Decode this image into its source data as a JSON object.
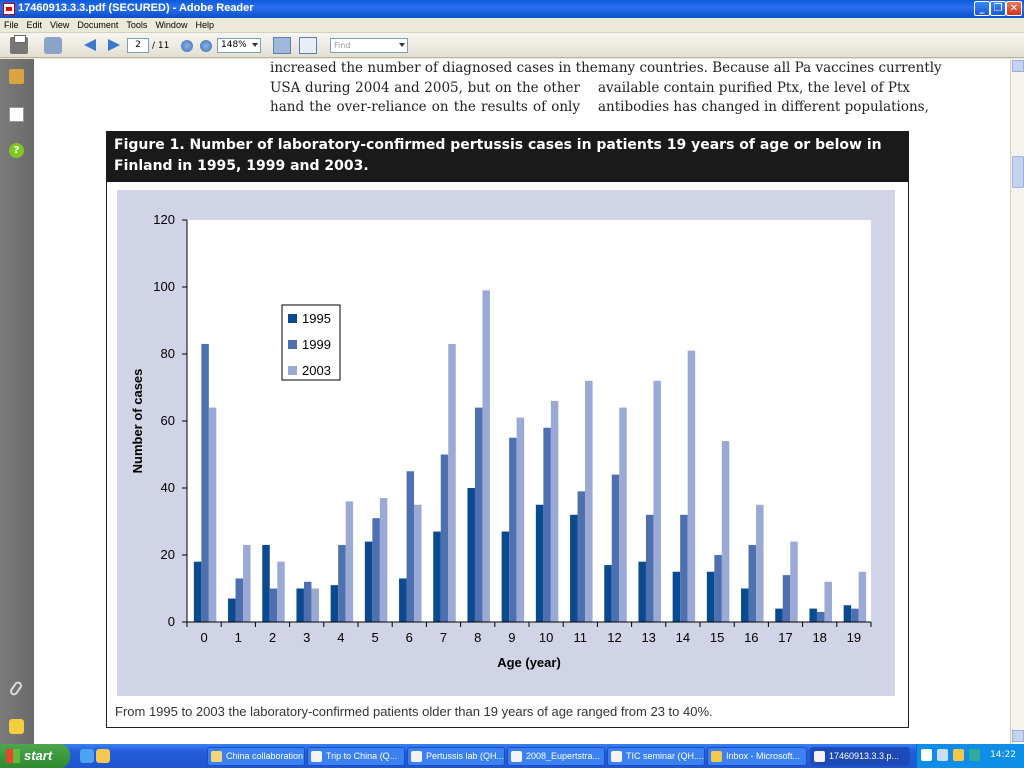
{
  "window": {
    "title": "17460913.3.3.pdf (SECURED) - Adobe Reader",
    "buttons": {
      "minimize": "_",
      "restore": "❐",
      "close": "✕"
    }
  },
  "menu": [
    "File",
    "Edit",
    "View",
    "Document",
    "Tools",
    "Window",
    "Help"
  ],
  "toolbar": {
    "page_current": "2",
    "page_total": "/ 11",
    "zoom": "148%",
    "find_placeholder": "Find"
  },
  "document": {
    "left_col": [
      "increased the number of diagnosed cases in the",
      "USA during 2004 and 2005, but on the other",
      "hand the over-reliance on the results of only"
    ],
    "right_col": [
      "many countries. Because all Pa vaccines currently",
      "available contain purified Ptx, the level of Ptx",
      "antibodies has changed in different populations,"
    ],
    "figure_title": "Figure 1. Number of laboratory-confirmed pertussis cases in patients 19 years of age or below in Finland in 1995, 1999 and 2003.",
    "figure_caption": "From 1995 to 2003 the laboratory-confirmed patients older than 19 years of age ranged from 23 to 40%."
  },
  "chart_data": {
    "type": "bar",
    "title": "",
    "xlabel": "Age (year)",
    "ylabel": "Number of cases",
    "ylim": [
      0,
      120
    ],
    "yticks": [
      0,
      20,
      40,
      60,
      80,
      100,
      120
    ],
    "categories": [
      "0",
      "1",
      "2",
      "3",
      "4",
      "5",
      "6",
      "7",
      "8",
      "9",
      "10",
      "11",
      "12",
      "13",
      "14",
      "15",
      "16",
      "17",
      "18",
      "19"
    ],
    "series": [
      {
        "name": "1995",
        "color": "#0a4a8f",
        "values": [
          18,
          7,
          23,
          10,
          11,
          24,
          13,
          27,
          40,
          27,
          35,
          32,
          17,
          18,
          15,
          15,
          10,
          4,
          4,
          5
        ]
      },
      {
        "name": "1999",
        "color": "#4f70b0",
        "values": [
          83,
          13,
          10,
          12,
          23,
          31,
          45,
          50,
          64,
          55,
          58,
          39,
          44,
          32,
          32,
          20,
          23,
          14,
          3,
          4
        ]
      },
      {
        "name": "2003",
        "color": "#9aaad4",
        "values": [
          64,
          23,
          18,
          10,
          36,
          37,
          35,
          83,
          99,
          61,
          66,
          72,
          64,
          72,
          81,
          54,
          35,
          24,
          12,
          15
        ]
      }
    ],
    "legend_position": "upper-left inside plot",
    "grid": false
  },
  "taskbar": {
    "start_label": "start",
    "tasks": [
      "China collaboration",
      "Trip to China (Q...",
      "Pertussis lab (QH...",
      "2008_Eupertstra...",
      "TIC seminar (QH....",
      "Inbox - Microsoft...",
      "17460913.3.3.p..."
    ],
    "clock": "14:22"
  }
}
